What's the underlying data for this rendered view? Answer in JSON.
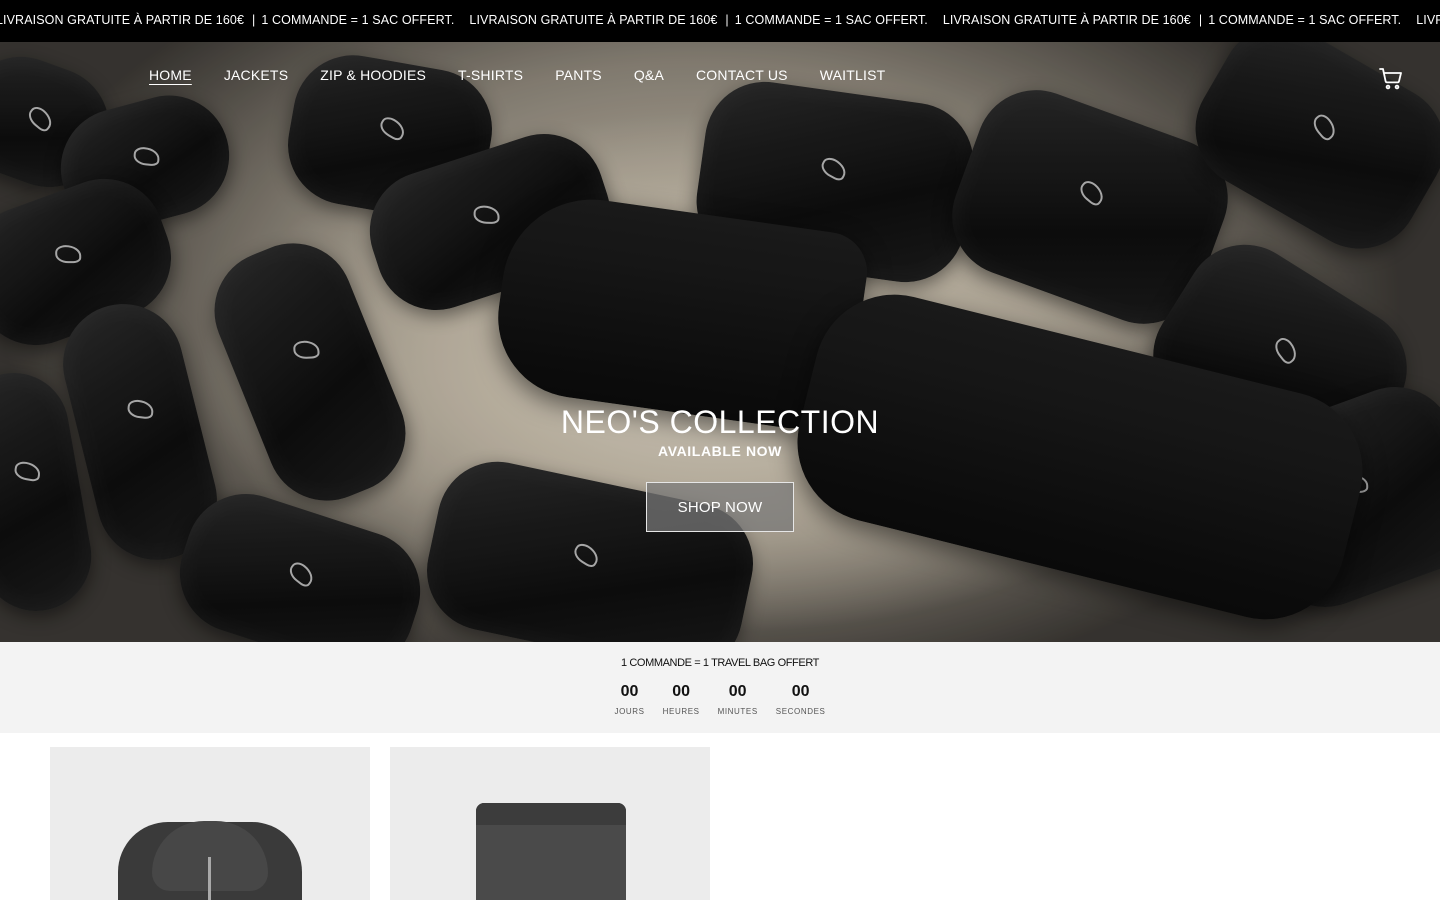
{
  "announcement": {
    "messages": [
      {
        "text": "LIVRAISON GRATUITE À PARTIR DE 160€",
        "sep": "|",
        "text2": "1 COMMANDE = 1 SAC OFFERT."
      },
      {
        "text": "LIVRAISON GRATUITE À PARTIR DE 160€",
        "sep": "|",
        "text2": "1 COMMANDE = 1 SAC OFFERT."
      },
      {
        "text": "LIVRAISON GRATUITE À PARTIR DE 160€",
        "sep": "|",
        "text2": "1 COMMANDE = 1 SAC OFFERT."
      },
      {
        "text": "LIVRAISON GRATUIT"
      }
    ]
  },
  "nav": {
    "items": [
      "HOME",
      "JACKETS",
      "ZIP & HOODIES",
      "T-SHIRTS",
      "PANTS",
      "Q&A",
      "CONTACT US",
      "WAITLIST"
    ],
    "active": "HOME"
  },
  "header": {
    "cart_icon": "cart-icon"
  },
  "hero": {
    "title": "NEO'S COLLECTION",
    "subtitle": "AVAILABLE NOW",
    "button_label": "SHOP NOW"
  },
  "countdown": {
    "title": "1 COMMANDE = 1 TRAVEL BAG OFFERT",
    "units": [
      {
        "value": "00",
        "label": "JOURS"
      },
      {
        "value": "00",
        "label": "HEURES"
      },
      {
        "value": "00",
        "label": "MINUTES"
      },
      {
        "value": "00",
        "label": "SECONDES"
      }
    ]
  },
  "products": [
    {
      "image": "zip-hoodie-image"
    },
    {
      "image": "pants-image"
    }
  ],
  "colors": {
    "announce_bg": "#000000",
    "countdown_bg": "#f3f3f3",
    "product_bg": "#ececec",
    "button_bg": "#787878"
  }
}
